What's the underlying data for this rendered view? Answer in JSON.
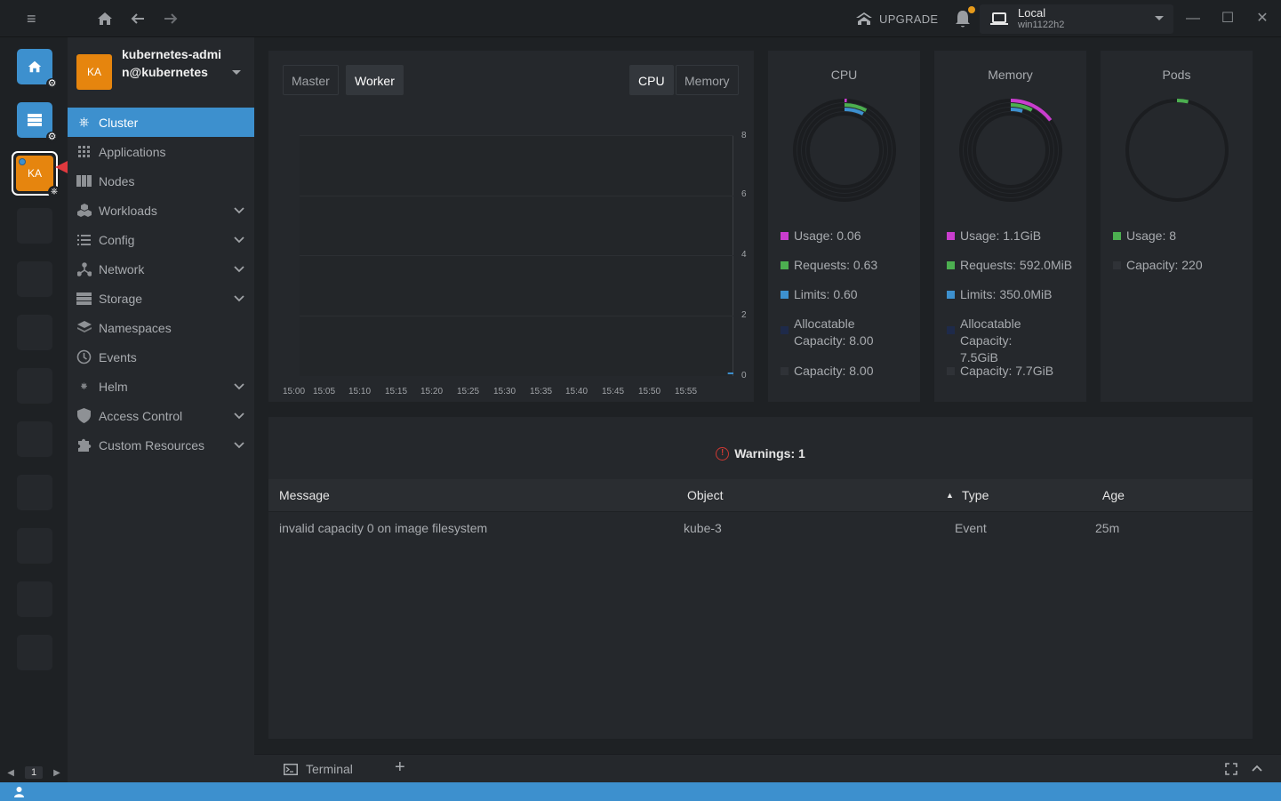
{
  "titlebar": {
    "upgrade_label": "UPGRADE",
    "cluster_name": "Local",
    "cluster_sub": "win1122h2"
  },
  "hotbar": {
    "active_cluster_initials": "KA",
    "page": "1"
  },
  "sidebar": {
    "avatar_initials": "KA",
    "cluster_name": "kubernetes-admin@kubernetes",
    "items": [
      {
        "label": "Cluster",
        "icon": "helm-wheel-icon"
      },
      {
        "label": "Applications",
        "icon": "grid-icon"
      },
      {
        "label": "Nodes",
        "icon": "nodes-icon"
      },
      {
        "label": "Workloads",
        "icon": "cubes-icon"
      },
      {
        "label": "Config",
        "icon": "list-icon"
      },
      {
        "label": "Network",
        "icon": "network-icon"
      },
      {
        "label": "Storage",
        "icon": "storage-icon"
      },
      {
        "label": "Namespaces",
        "icon": "layers-icon"
      },
      {
        "label": "Events",
        "icon": "clock-icon"
      },
      {
        "label": "Helm",
        "icon": "helm-icon"
      },
      {
        "label": "Access Control",
        "icon": "shield-icon"
      },
      {
        "label": "Custom Resources",
        "icon": "puzzle-icon"
      }
    ]
  },
  "chart_panel": {
    "tabs": [
      "Master",
      "Worker"
    ],
    "active_tab": "Worker",
    "metric_tabs": [
      "CPU",
      "Memory"
    ],
    "active_metric": "CPU",
    "chart_data": {
      "type": "line",
      "x": [
        "15:00",
        "15:05",
        "15:10",
        "15:15",
        "15:20",
        "15:25",
        "15:30",
        "15:35",
        "15:40",
        "15:45",
        "15:50",
        "15:55"
      ],
      "y_ticks": [
        "8",
        "6",
        "4",
        "2",
        "0"
      ],
      "ylim": [
        0,
        8
      ],
      "series": [
        {
          "values": [
            null,
            null,
            null,
            null,
            null,
            null,
            null,
            null,
            null,
            null,
            null,
            0.06
          ],
          "color": "#3d90ce"
        }
      ]
    }
  },
  "stats": {
    "cpu": {
      "title": "CPU",
      "usage": "Usage: 0.06",
      "requests": "Requests: 0.63",
      "limits": "Limits: 0.60",
      "allocatable": "Allocatable Capacity: 8.00",
      "capacity": "Capacity: 8.00",
      "usage_fraction": 0.0075,
      "requests_fraction": 0.079,
      "limits_fraction": 0.075
    },
    "memory": {
      "title": "Memory",
      "usage": "Usage: 1.1GiB",
      "requests": "Requests: 592.0MiB",
      "limits": "Limits: 350.0MiB",
      "allocatable": "Allocatable Capacity: 7.5GiB",
      "capacity": "Capacity: 7.7GiB",
      "usage_fraction": 0.147,
      "requests_fraction": 0.077,
      "limits_fraction": 0.046
    },
    "pods": {
      "title": "Pods",
      "usage": "Usage: 8",
      "capacity": "Capacity: 220",
      "usage_fraction": 0.036
    }
  },
  "colors": {
    "usage": "#c93dce",
    "requests": "#4caf50",
    "limits": "#3d90ce",
    "allocatable": "#1e2a4a",
    "capacity": "#2f3237",
    "accent": "#3d90ce",
    "avatar": "#e6850e"
  },
  "warnings": {
    "title": "Warnings: 1",
    "columns": [
      "Message",
      "Object",
      "Type",
      "Age"
    ],
    "rows": [
      [
        "invalid capacity 0 on image filesystem",
        "kube-3",
        "Event",
        "25m"
      ]
    ]
  },
  "dock": {
    "terminal_label": "Terminal"
  }
}
